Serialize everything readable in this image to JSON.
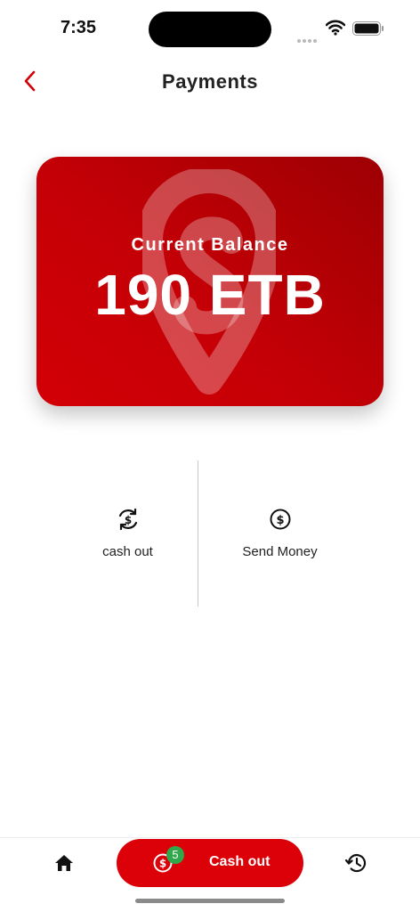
{
  "status_bar": {
    "time": "7:35",
    "icons": [
      "signal-icon",
      "wifi-icon",
      "battery-icon"
    ]
  },
  "header": {
    "title": "Payments",
    "back_icon": "chevron-left-icon"
  },
  "balance_card": {
    "label": "Current Balance",
    "amount": "190 ETB",
    "logo_icon": "location-pin-logo"
  },
  "actions": [
    {
      "label": "cash out",
      "icon": "currency-exchange-icon"
    },
    {
      "label": "Send Money",
      "icon": "dollar-circle-icon"
    }
  ],
  "bottom_nav": {
    "home_icon": "home-icon",
    "cashout": {
      "label": "Cash out",
      "badge": "5",
      "icon": "dollar-circle-icon"
    },
    "history_icon": "history-icon"
  },
  "colors": {
    "accent": "#dc0009",
    "card_dark": "#9d0003",
    "badge": "#2ea84a"
  }
}
